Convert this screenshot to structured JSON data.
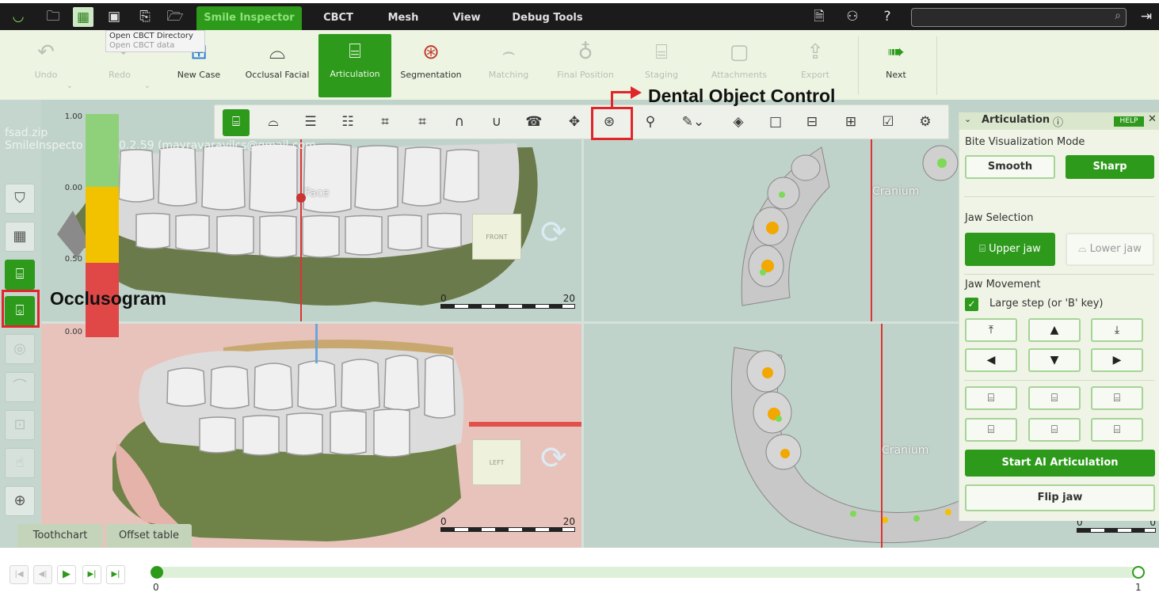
{
  "menubar": {
    "tabs": [
      "Smile Inspector",
      "CBCT",
      "Mesh",
      "View",
      "Debug Tools"
    ],
    "active_tab": "Smile Inspector",
    "icons": [
      "logo-icon",
      "folder-open-icon",
      "cbct-directory-icon",
      "save-icon",
      "save-as-icon",
      "folder-export-icon"
    ],
    "right_icons": [
      "document-icon",
      "hierarchy-icon",
      "help-icon",
      "logout-icon"
    ],
    "search_value": ""
  },
  "tooltip": {
    "title": "Open CBCT Directory",
    "subtitle": "Open CBCT data"
  },
  "ribbon": {
    "buttons": [
      {
        "label": "Undo",
        "icon": "undo-icon",
        "state": "disabled"
      },
      {
        "label": "Redo",
        "icon": "redo-icon",
        "state": "disabled"
      },
      {
        "label": "New Case",
        "icon": "new-case-icon",
        "state": "normal"
      },
      {
        "label": "Occlusal Facial",
        "icon": "occlusal-facial-icon",
        "state": "normal"
      },
      {
        "label": "Articulation",
        "icon": "articulation-icon",
        "state": "active"
      },
      {
        "label": "Segmentation",
        "icon": "segmentation-icon",
        "state": "normal"
      },
      {
        "label": "Matching",
        "icon": "matching-icon",
        "state": "disabled"
      },
      {
        "label": "Final Position",
        "icon": "final-position-icon",
        "state": "disabled"
      },
      {
        "label": "Staging",
        "icon": "staging-icon",
        "state": "disabled"
      },
      {
        "label": "Attachments",
        "icon": "attachments-icon",
        "state": "disabled"
      },
      {
        "label": "Export",
        "icon": "export-icon",
        "state": "disabled"
      },
      {
        "label": "Next",
        "icon": "next-icon",
        "state": "normal"
      }
    ]
  },
  "viewport": {
    "file_name": "fsad.zip",
    "app_info_prefix": "SmileInspecto",
    "app_info_suffix": "0.2.59 (mayravaravilcs@gmail.com",
    "legend_values": [
      "1.00",
      "0.00",
      "0.50",
      "0.00"
    ],
    "legend_colors": [
      "#8fd17a",
      "#f2c200",
      "#e04848"
    ],
    "labels": {
      "face": "Face",
      "cranium_top": "Cranium",
      "cranium_bottom": "Cranium"
    },
    "orient_front": "FRONT",
    "orient_left": "LEFT",
    "scale_top": {
      "min": "0",
      "max": "20"
    },
    "scale_bottom": {
      "min": "0",
      "max": "20"
    },
    "scale_right": {
      "min": "0",
      "max": "0"
    }
  },
  "view_toolbar": {
    "icons": [
      "upper-jaw-view-icon",
      "lower-jaw-view-icon",
      "front-view-icon",
      "back-view-icon",
      "left-view-icon",
      "right-view-icon",
      "top-view-icon",
      "bottom-view-icon",
      "occlusal-view-icon",
      "move-icon",
      "dental-object-control-icon",
      "tooth-select-icon",
      "paint-icon",
      "hide-icon",
      "single-view-icon",
      "split-horizontal-icon",
      "quad-view-icon",
      "check-icon",
      "settings-icon"
    ]
  },
  "left_tools": [
    "tooth-chart-icon",
    "grid-icon",
    "jaw-align-icon",
    "occlusogram-icon",
    "jaw-icon",
    "arch-icon",
    "bracket-icon",
    "gesture-icon",
    "search-tooth-icon"
  ],
  "bottom_tabs": [
    "Toothchart",
    "Offset table"
  ],
  "panel": {
    "title": "Articulation",
    "help": "HELP",
    "bite_mode_label": "Bite Visualization Mode",
    "bite_modes": [
      "Smooth",
      "Sharp"
    ],
    "bite_mode_selected": "Sharp",
    "jaw_selection_label": "Jaw Selection",
    "jaws": [
      "Upper jaw",
      "Lower jaw"
    ],
    "jaw_selected": "Upper jaw",
    "jaw_movement_label": "Jaw Movement",
    "large_step_label": "Large step (or 'B' key)",
    "large_step_checked": true,
    "start_ai": "Start AI Articulation",
    "flip_jaw": "Flip jaw"
  },
  "playback": {
    "start_label": "0",
    "end_label": "1",
    "position": 0
  },
  "annotations": {
    "dental_object_control": "Dental Object Control",
    "occlusogram": "Occlusogram"
  }
}
